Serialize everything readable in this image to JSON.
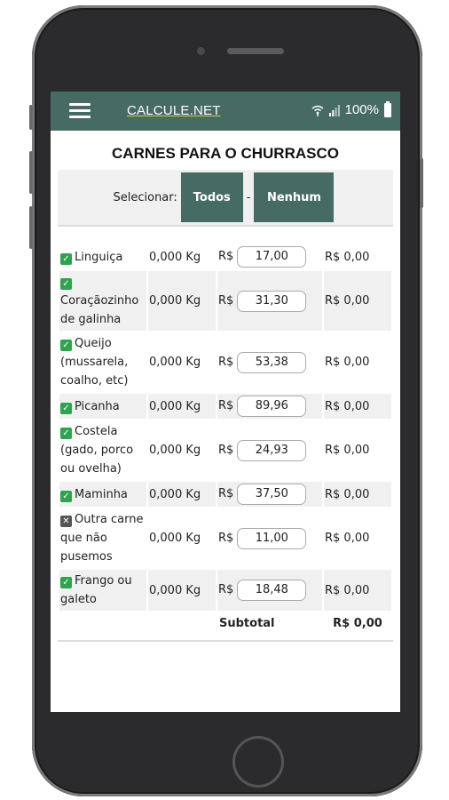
{
  "appbar": {
    "brand": "CALCULE.NET",
    "battery": "100%",
    "icons": [
      "menu-icon",
      "wifi-icon",
      "signal-icon",
      "battery-icon"
    ]
  },
  "title": "CARNES PARA O CHURRASCO",
  "selector": {
    "label": "Selecionar:",
    "all": "Todos",
    "separator": "-",
    "none": "Nenhum"
  },
  "currency": "R$",
  "rows": [
    {
      "checked": true,
      "name": "Linguiça",
      "qty": "0,000 Kg",
      "price": "17,00",
      "total": "R$ 0,00"
    },
    {
      "checked": true,
      "name": "Coraçãozinho de galinha",
      "qty": "0,000 Kg",
      "price": "31,30",
      "total": "R$ 0,00"
    },
    {
      "checked": true,
      "name": "Queijo (mussarela, coalho, etc)",
      "qty": "0,000 Kg",
      "price": "53,38",
      "total": "R$ 0,00"
    },
    {
      "checked": true,
      "name": "Picanha",
      "qty": "0,000 Kg",
      "price": "89,96",
      "total": "R$ 0,00"
    },
    {
      "checked": true,
      "name": "Costela (gado, porco ou ovelha)",
      "qty": "0,000 Kg",
      "price": "24,93",
      "total": "R$ 0,00"
    },
    {
      "checked": true,
      "name": "Maminha",
      "qty": "0,000 Kg",
      "price": "37,50",
      "total": "R$ 0,00"
    },
    {
      "checked": false,
      "name": "Outra carne que não pusemos",
      "qty": "0,000 Kg",
      "price": "11,00",
      "total": "R$ 0,00"
    },
    {
      "checked": true,
      "name": "Frango ou galeto",
      "qty": "0,000 Kg",
      "price": "18,48",
      "total": "R$ 0,00"
    }
  ],
  "subtotal": {
    "label": "Subtotal",
    "value": "R$ 0,00"
  }
}
